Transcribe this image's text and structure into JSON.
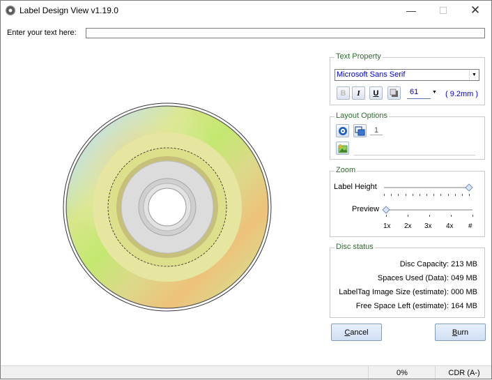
{
  "window": {
    "title": "Label Design View v1.19.0",
    "controls": {
      "minimize": "—",
      "maximize": "☐",
      "close": "✕"
    }
  },
  "text_entry": {
    "prompt": "Enter your text here:",
    "value": ""
  },
  "text_property": {
    "group_title": "Text Property",
    "font_name": "Microsoft Sans Serif",
    "bold_label": "B",
    "italic_label": "I",
    "underline_label": "U",
    "font_size": "61",
    "font_size_mm": "( 9.2mm )"
  },
  "layout_options": {
    "group_title": "Layout Options",
    "count": "1"
  },
  "zoom": {
    "group_title": "Zoom",
    "label_height_text": "Label Height",
    "preview_text": "Preview",
    "levels": [
      "1x",
      "2x",
      "3x",
      "4x",
      "#"
    ],
    "label_height_level": 1.0,
    "preview_level": 0.0
  },
  "disc_status": {
    "group_title": "Disc status",
    "rows": [
      {
        "label": "Disc Capacity:",
        "value": "213 MB"
      },
      {
        "label": "Spaces Used (Data):",
        "value": "049 MB"
      },
      {
        "label": "LabelTag Image Size (estimate):",
        "value": "000 MB"
      },
      {
        "label": "Free Space Left (estimate):",
        "value": "164 MB"
      }
    ]
  },
  "buttons": {
    "cancel": "Cancel",
    "burn": "Burn"
  },
  "status_bar": {
    "progress": "0%",
    "drive": "CDR (A-)"
  },
  "colors": {
    "group_title": "#2a6e2a",
    "accent_text": "#0000cc"
  },
  "icons": {
    "app": "disc-icon",
    "layout_a": "disc-layout-icon",
    "layout_b": "copy-layout-icon",
    "image": "insert-image-icon"
  }
}
